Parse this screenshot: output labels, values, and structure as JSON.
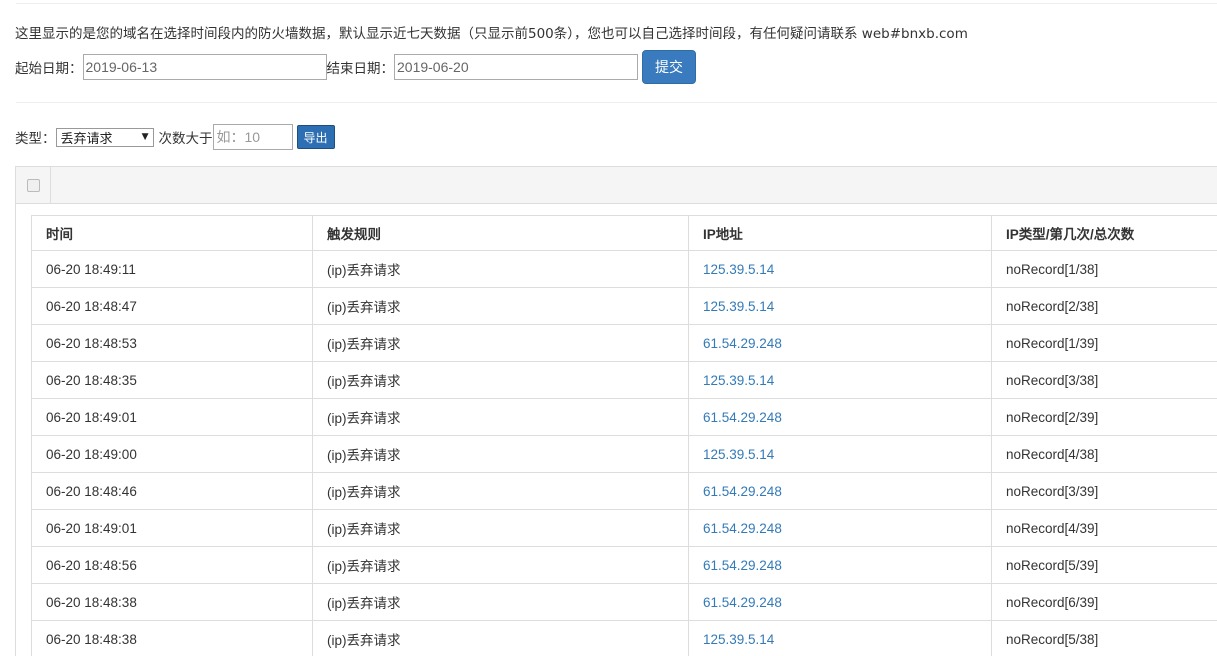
{
  "notice": "这里显示的是您的域名在选择时间段内的防火墙数据，默认显示近七天数据（只显示前500条），您也可以自己选择时间段，有任何疑问请联系 web#bnxb.com",
  "date_filter": {
    "start_label": "起始日期：",
    "start_value": "2019-06-13",
    "end_label": "结束日期：",
    "end_value": "2019-06-20",
    "submit_label": "提交"
  },
  "filter": {
    "type_label": "类型：",
    "type_selected": "丢弃请求",
    "count_label": "次数大于",
    "count_placeholder": "如：10",
    "export_label": "导出"
  },
  "table": {
    "headers": [
      "时间",
      "触发规则",
      "IP地址",
      "IP类型/第几次/总次数"
    ],
    "rows": [
      [
        "06-20 18:49:11",
        "(ip)丢弃请求",
        "125.39.5.14",
        "noRecord[1/38]"
      ],
      [
        "06-20 18:48:47",
        "(ip)丢弃请求",
        "125.39.5.14",
        "noRecord[2/38]"
      ],
      [
        "06-20 18:48:53",
        "(ip)丢弃请求",
        "61.54.29.248",
        "noRecord[1/39]"
      ],
      [
        "06-20 18:48:35",
        "(ip)丢弃请求",
        "125.39.5.14",
        "noRecord[3/38]"
      ],
      [
        "06-20 18:49:01",
        "(ip)丢弃请求",
        "61.54.29.248",
        "noRecord[2/39]"
      ],
      [
        "06-20 18:49:00",
        "(ip)丢弃请求",
        "125.39.5.14",
        "noRecord[4/38]"
      ],
      [
        "06-20 18:48:46",
        "(ip)丢弃请求",
        "61.54.29.248",
        "noRecord[3/39]"
      ],
      [
        "06-20 18:49:01",
        "(ip)丢弃请求",
        "61.54.29.248",
        "noRecord[4/39]"
      ],
      [
        "06-20 18:48:56",
        "(ip)丢弃请求",
        "61.54.29.248",
        "noRecord[5/39]"
      ],
      [
        "06-20 18:48:38",
        "(ip)丢弃请求",
        "61.54.29.248",
        "noRecord[6/39]"
      ],
      [
        "06-20 18:48:38",
        "(ip)丢弃请求",
        "125.39.5.14",
        "noRecord[5/38]"
      ]
    ]
  },
  "colors": {
    "link": "#337ab7",
    "primary_button": "#3a7bbf",
    "border": "#dddddd"
  }
}
